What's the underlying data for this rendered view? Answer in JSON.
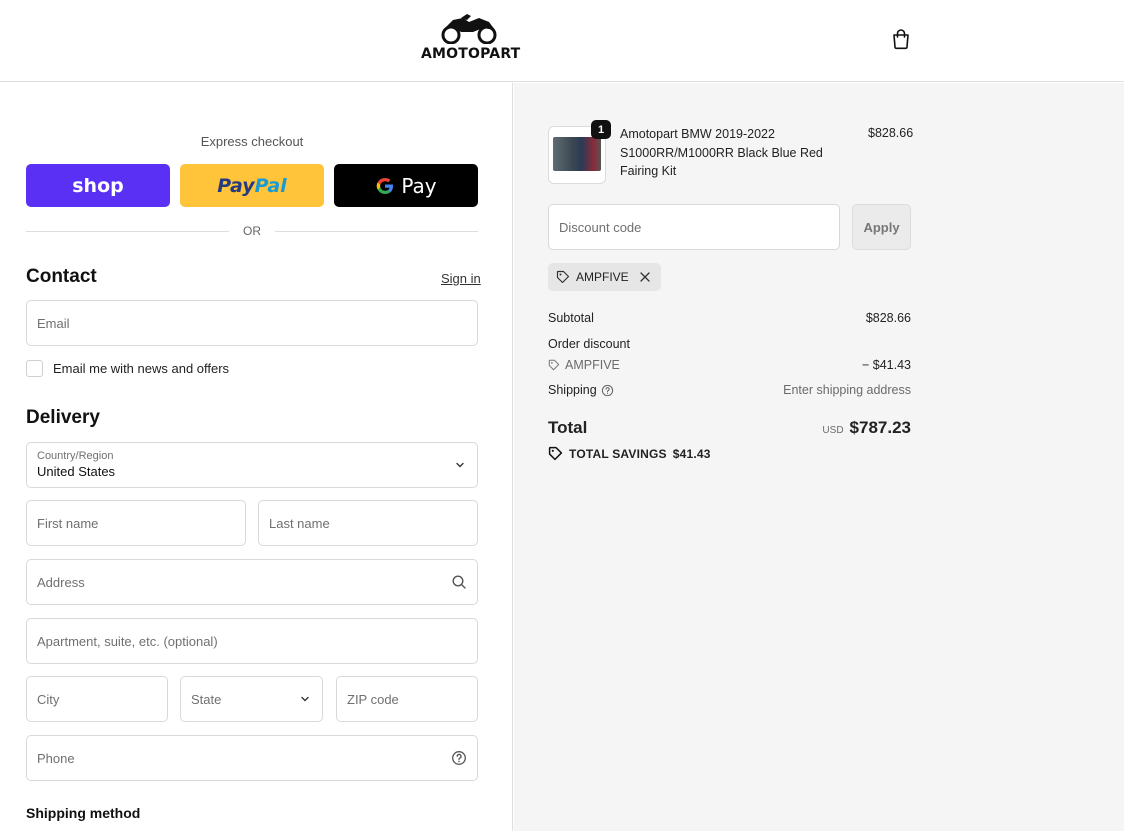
{
  "brand": {
    "name": "AMOTOPART"
  },
  "header": {
    "cart_icon": "shopping-bag-icon"
  },
  "express": {
    "title": "Express checkout",
    "shop_label": "shop",
    "paypal_label_1": "Pay",
    "paypal_label_2": "Pal",
    "gpay_label": "Pay",
    "or_label": "OR"
  },
  "contact": {
    "heading": "Contact",
    "signin_label": "Sign in",
    "email_placeholder": "Email",
    "newsletter_label": "Email me with news and offers"
  },
  "delivery": {
    "heading": "Delivery",
    "country_label": "Country/Region",
    "country_value": "United States",
    "first_name_placeholder": "First name",
    "last_name_placeholder": "Last name",
    "address_placeholder": "Address",
    "apartment_placeholder": "Apartment, suite, etc. (optional)",
    "city_placeholder": "City",
    "state_placeholder": "State",
    "zip_placeholder": "ZIP code",
    "phone_placeholder": "Phone"
  },
  "shipping_method": {
    "heading": "Shipping method"
  },
  "order": {
    "quantity": "1",
    "product_name": "Amotopart BMW 2019-2022 S1000RR/M1000RR Black Blue Red Fairing Kit",
    "product_price": "$828.66",
    "discount_placeholder": "Discount code",
    "apply_label": "Apply",
    "applied_code": "AMPFIVE"
  },
  "summary": {
    "subtotal_label": "Subtotal",
    "subtotal_value": "$828.66",
    "order_discount_label": "Order discount",
    "discount_code": "AMPFIVE",
    "discount_value": "− $41.43",
    "shipping_label": "Shipping",
    "shipping_value": "Enter shipping address",
    "total_label": "Total",
    "currency": "USD",
    "total_value": "$787.23",
    "savings_label": "TOTAL SAVINGS",
    "savings_value": "$41.43"
  },
  "colors": {
    "shop_purple": "#5a31f4",
    "paypal_yellow": "#ffc439",
    "gpay_black": "#000000",
    "summary_bg": "#f5f5f5"
  }
}
